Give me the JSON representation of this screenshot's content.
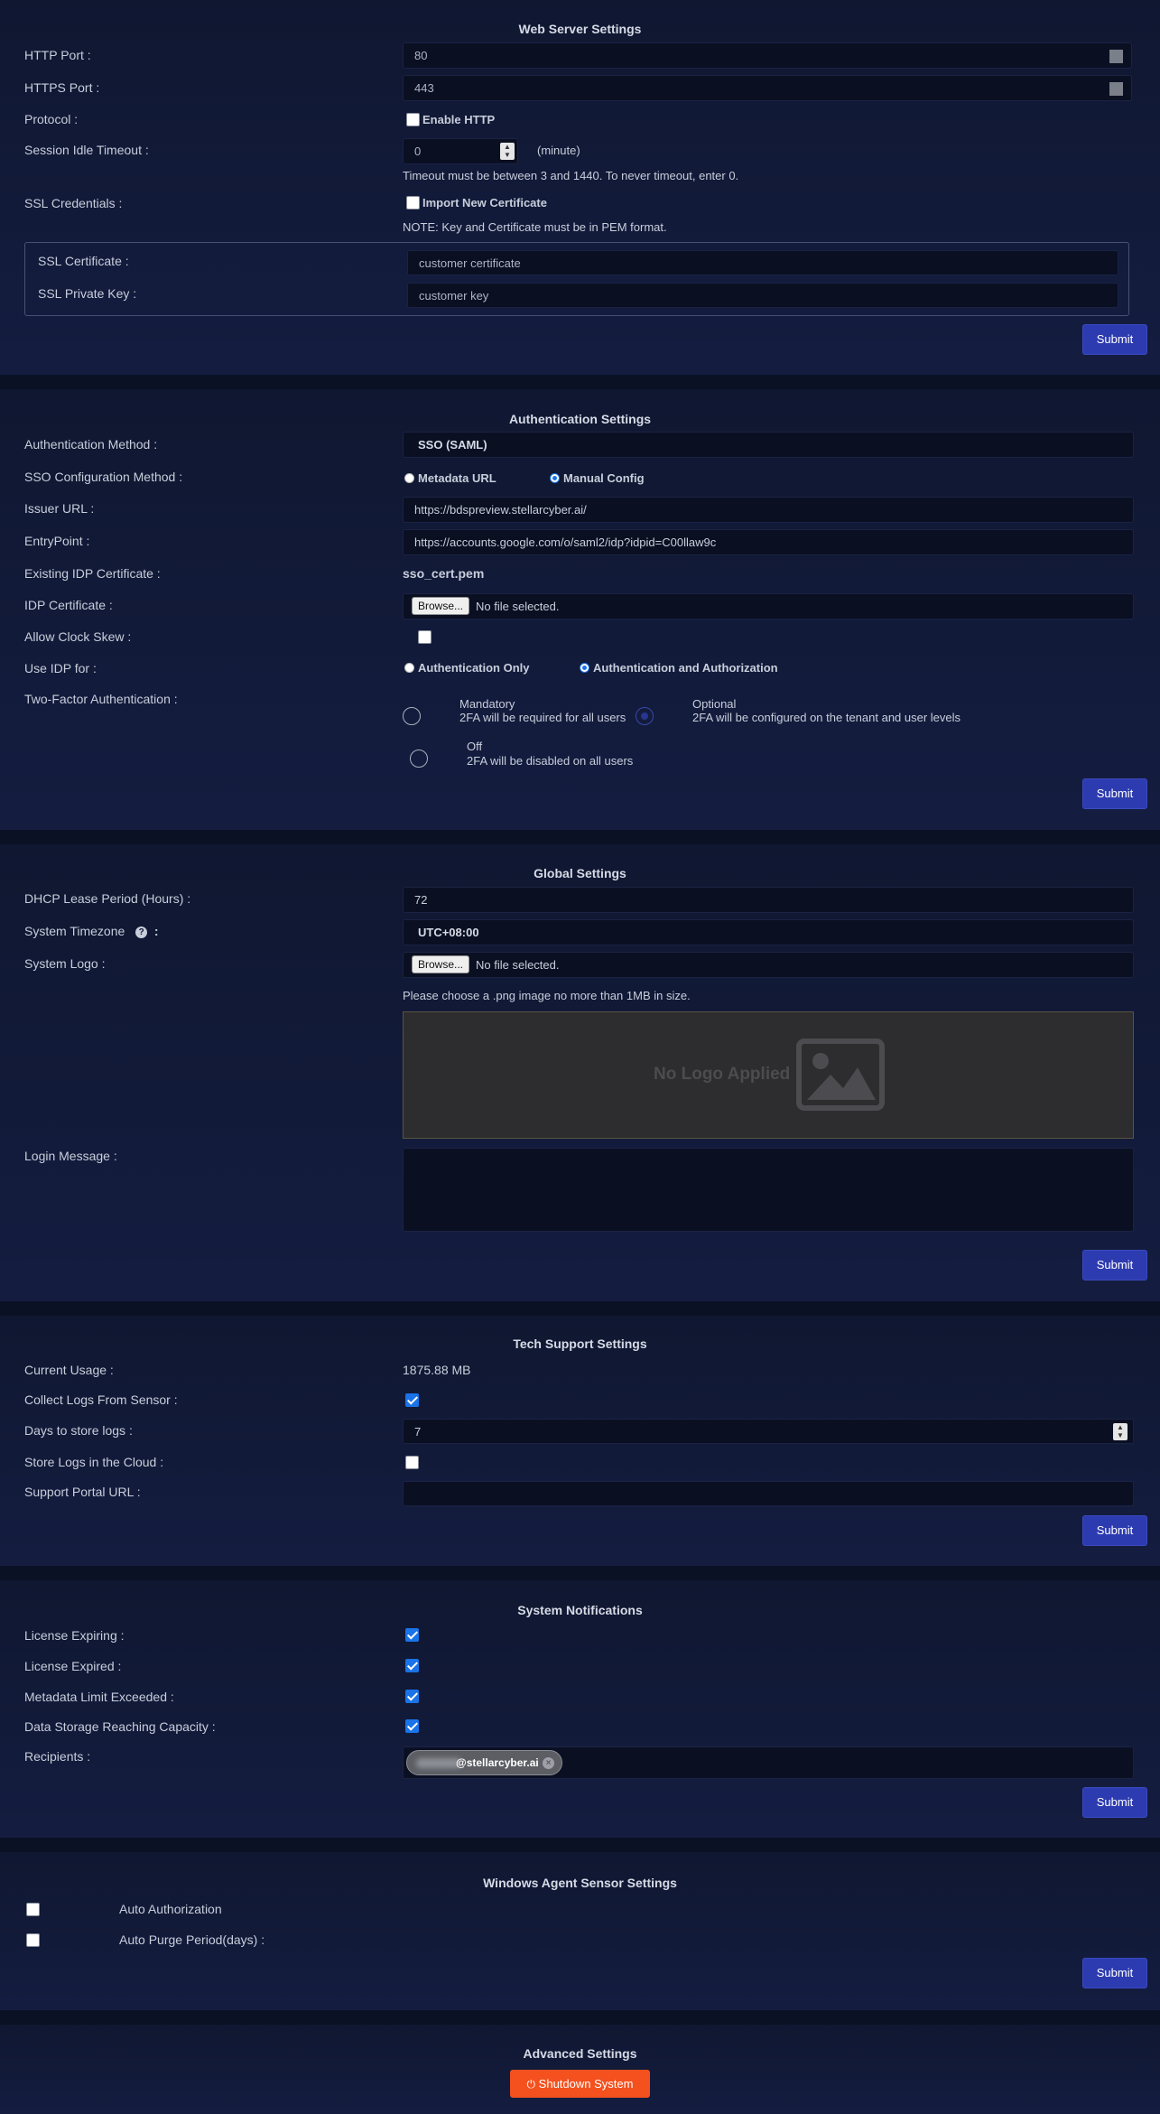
{
  "web_server": {
    "title": "Web Server Settings",
    "http_port_label": "HTTP Port :",
    "http_port_value": "80",
    "https_port_label": "HTTPS Port :",
    "https_port_value": "443",
    "protocol_label": "Protocol :",
    "enable_http_label": "Enable HTTP",
    "session_label": "Session Idle Timeout :",
    "session_value": "0",
    "session_unit": "(minute)",
    "session_hint": "Timeout must be between 3 and 1440. To never timeout, enter 0.",
    "ssl_label": "SSL Credentials :",
    "import_cert_label": "Import New Certificate",
    "pem_note": "NOTE: Key and Certificate must be in PEM format.",
    "ssl_cert_label": "SSL Certificate :",
    "ssl_cert_value": "customer certificate",
    "ssl_key_label": "SSL Private Key :",
    "ssl_key_value": "customer key",
    "submit_label": "Submit"
  },
  "auth": {
    "title": "Authentication Settings",
    "method_label": "Authentication Method :",
    "method_value": "SSO (SAML)",
    "sso_config_label": "SSO Configuration Method :",
    "metadata_url_option": "Metadata URL",
    "manual_config_option": "Manual Config",
    "issuer_label": "Issuer URL :",
    "issuer_value": "https://bdspreview.stellarcyber.ai/",
    "entry_label": "EntryPoint :",
    "entry_value": "https://accounts.google.com/o/saml2/idp?idpid=C00llaw9c",
    "existing_cert_label": "Existing IDP Certificate :",
    "existing_cert_value": "sso_cert.pem",
    "idp_cert_label": "IDP Certificate :",
    "browse_label": "Browse...",
    "no_file_label": "No file selected.",
    "clock_skew_label": "Allow Clock Skew :",
    "use_idp_label": "Use IDP for  :",
    "auth_only_option": "Authentication Only",
    "auth_and_authz_option": "Authentication and Authorization",
    "twofa_label": "Two-Factor Authentication :",
    "mandatory_title": "Mandatory",
    "mandatory_desc": "2FA will be required for all users",
    "optional_title": "Optional",
    "optional_desc": "2FA will be configured on the tenant and user levels",
    "off_title": "Off",
    "off_desc": "2FA will be disabled on all users",
    "submit_label": "Submit"
  },
  "global": {
    "title": "Global Settings",
    "dhcp_label": "DHCP Lease Period (Hours) :",
    "dhcp_value": "72",
    "tz_label": "System Timezone",
    "tz_value": "UTC+08:00",
    "tz_help_icon": "question-circle-icon",
    "logo_label": "System Logo :",
    "browse_label": "Browse...",
    "no_file_label": "No file selected.",
    "logo_hint": "Please choose a .png image no more than 1MB in size.",
    "no_logo_text": "No Logo Applied",
    "login_message_label": "Login Message :",
    "login_message_value": "",
    "submit_label": "Submit"
  },
  "tech": {
    "title": "Tech Support Settings",
    "usage_label": "Current Usage :",
    "usage_value": "1875.88 MB",
    "collect_label": "Collect Logs From Sensor :",
    "days_label": "Days to store logs :",
    "days_value": "7",
    "cloud_label": "Store Logs in the Cloud :",
    "portal_label": "Support Portal URL :",
    "portal_value": "",
    "submit_label": "Submit"
  },
  "notifications": {
    "title": "System Notifications",
    "license_expiring_label": "License Expiring :",
    "license_expired_label": "License Expired :",
    "metadata_limit_label": "Metadata Limit Exceeded :",
    "storage_label": "Data Storage Reaching Capacity :",
    "recipients_label": "Recipients :",
    "recipient_chip": "@stellarcyber.ai",
    "submit_label": "Submit"
  },
  "windows_agent": {
    "title": "Windows Agent Sensor Settings",
    "auto_auth_label": "Auto Authorization",
    "auto_purge_label": "Auto Purge Period(days) :",
    "submit_label": "Submit"
  },
  "advanced": {
    "title": "Advanced Settings",
    "shutdown_label": "Shutdown System",
    "shutdown_icon": "power-icon",
    "shutdown_color": "#f4511e"
  },
  "colors": {
    "background": "#0b1125",
    "panel": "#141d40",
    "submit": "#2c3bb0",
    "accent": "#1a73e8"
  }
}
